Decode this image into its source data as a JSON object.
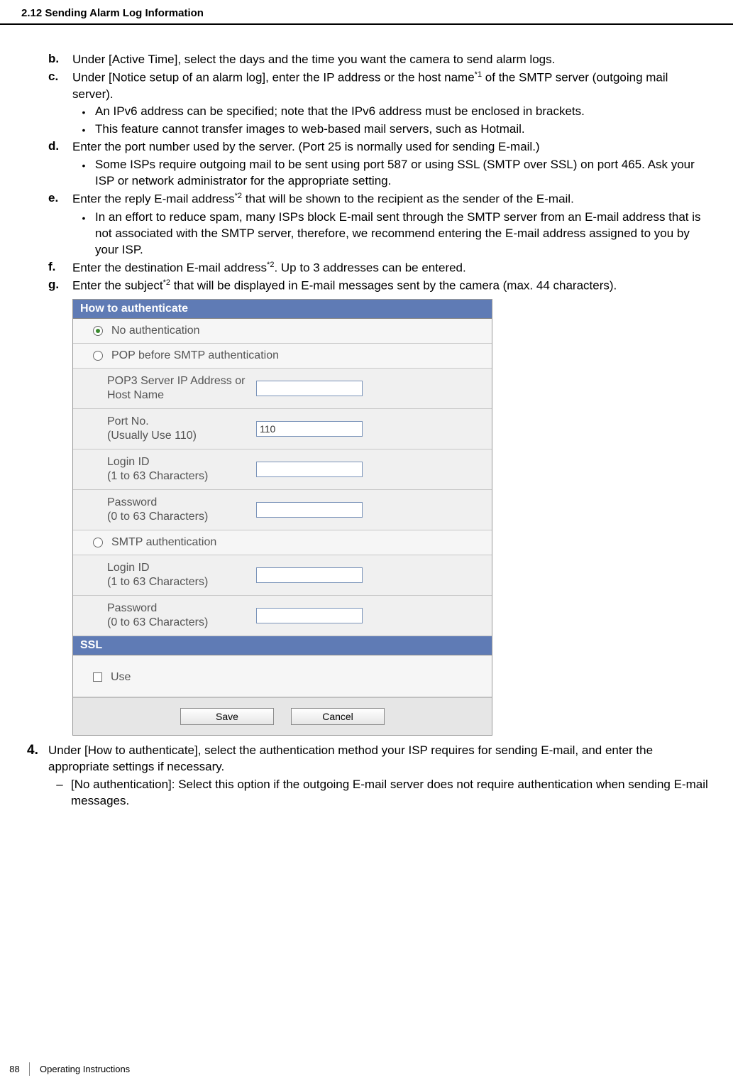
{
  "header": {
    "section_title": "2.12 Sending Alarm Log Information"
  },
  "steps": {
    "b": {
      "text": "Under [Active Time], select the days and the time you want the camera to send alarm logs."
    },
    "c": {
      "text_pre": "Under [Notice setup of an alarm log], enter the IP address or the host name",
      "sup": "*1",
      "text_post": " of the SMTP server (outgoing mail server).",
      "bullets": [
        "An IPv6 address can be specified; note that the IPv6 address must be enclosed in brackets.",
        "This feature cannot transfer images to web-based mail servers, such as Hotmail."
      ]
    },
    "d": {
      "text": "Enter the port number used by the server. (Port 25 is normally used for sending E-mail.)",
      "bullets": [
        "Some ISPs require outgoing mail to be sent using port 587 or using SSL (SMTP over SSL) on port 465. Ask your ISP or network administrator for the appropriate setting."
      ]
    },
    "e": {
      "text_pre": "Enter the reply E-mail address",
      "sup": "*2",
      "text_post": " that will be shown to the recipient as the sender of the E-mail.",
      "bullets": [
        "In an effort to reduce spam, many ISPs block E-mail sent through the SMTP server from an E-mail address that is not associated with the SMTP server, therefore, we recommend entering the E-mail address assigned to you by your ISP."
      ]
    },
    "f": {
      "text_pre": "Enter the destination E-mail address",
      "sup": "*2",
      "text_post": ". Up to 3 addresses can be entered."
    },
    "g": {
      "text_pre": "Enter the subject",
      "sup": "*2",
      "text_post": " that will be displayed in E-mail messages sent by the camera (max. 44 characters)."
    }
  },
  "figure": {
    "title": "How to authenticate",
    "no_auth": "No authentication",
    "pop_before": "POP before SMTP authentication",
    "pop3_label": "POP3 Server IP Address or Host Name",
    "port_label": "Port No.\n(Usually Use 110)",
    "port_value": "110",
    "login_label": "Login ID\n(1 to 63 Characters)",
    "password_label": "Password\n(0 to 63 Characters)",
    "smtp_auth": "SMTP authentication",
    "ssl_title": "SSL",
    "ssl_use": "Use",
    "save": "Save",
    "cancel": "Cancel"
  },
  "step4": {
    "text": "Under [How to authenticate], select the authentication method your ISP requires for sending E-mail, and enter the appropriate settings if necessary.",
    "dash1": "[No authentication]: Select this option if the outgoing E-mail server does not require authentication when sending E-mail messages."
  },
  "footer": {
    "page_number": "88",
    "title": "Operating Instructions"
  }
}
